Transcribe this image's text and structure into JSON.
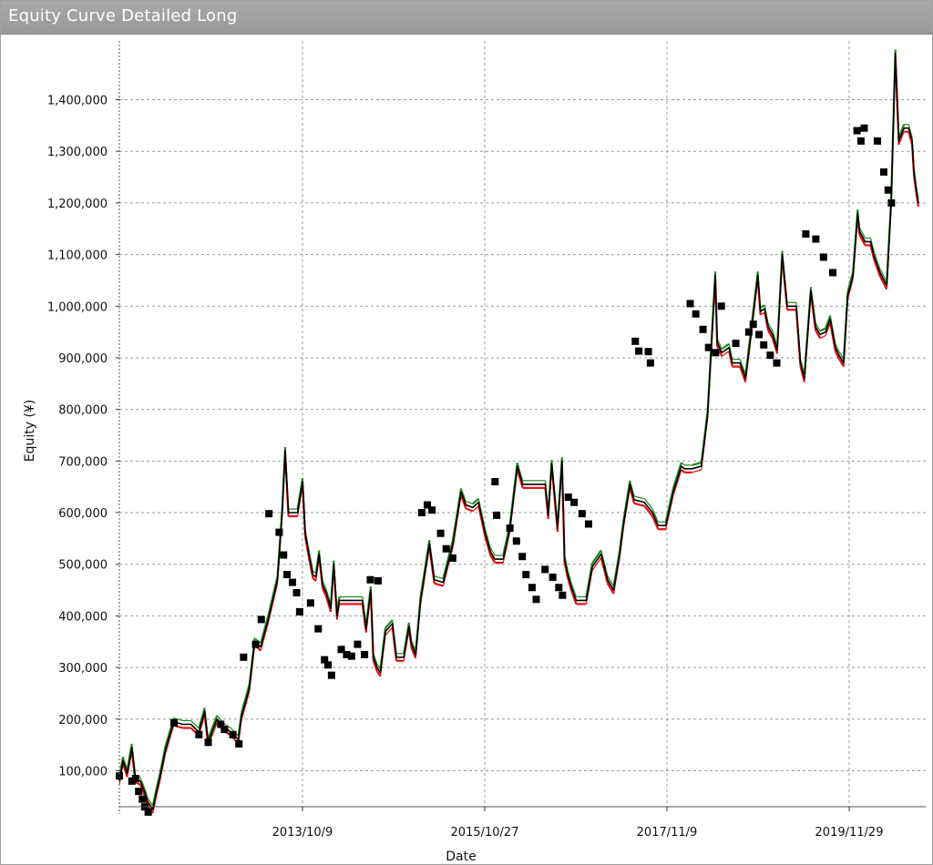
{
  "window": {
    "title": "Equity Curve Detailed Long"
  },
  "chart_data": {
    "type": "line",
    "title": "Equity Curve Detailed Long",
    "xlabel": "Date",
    "ylabel": "Equity (¥)",
    "ylim": [
      20000,
      1500000
    ],
    "xlim": [
      "2011-10-19",
      "2021-03-15"
    ],
    "grid": true,
    "x_tick_labels": [
      "2013/10/9",
      "2015/10/27",
      "2017/11/9",
      "2019/11/29"
    ],
    "y_ticks": [
      100000,
      200000,
      300000,
      400000,
      500000,
      600000,
      700000,
      800000,
      900000,
      1000000,
      1100000,
      1200000,
      1300000,
      1400000
    ],
    "y_tick_labels": [
      "100,000",
      "200,000",
      "300,000",
      "400,000",
      "500,000",
      "600,000",
      "700,000",
      "800,000",
      "900,000",
      "1,000,000",
      "1,100,000",
      "1,200,000",
      "1,300,000",
      "1,400,000"
    ],
    "colors": {
      "curve": "#000000",
      "gain_band": "#1a8a1a",
      "loss_band": "#e01010",
      "markers": "#000000"
    },
    "series": [
      {
        "values": [
          [
            "2011-10-19",
            80000
          ],
          [
            "2011-11-04",
            120000
          ],
          [
            "2011-11-22",
            95000
          ],
          [
            "2011-12-12",
            145000
          ],
          [
            "2011-12-27",
            85000
          ],
          [
            "2012-01-17",
            80000
          ],
          [
            "2012-02-04",
            60000
          ],
          [
            "2012-02-18",
            40000
          ],
          [
            "2012-03-11",
            25000
          ],
          [
            "2012-03-25",
            55000
          ],
          [
            "2012-04-12",
            90000
          ],
          [
            "2012-05-04",
            140000
          ],
          [
            "2012-06-09",
            195000
          ],
          [
            "2012-07-17",
            190000
          ],
          [
            "2012-08-22",
            190000
          ],
          [
            "2012-09-25",
            175000
          ],
          [
            "2012-10-20",
            215000
          ],
          [
            "2012-11-04",
            155000
          ],
          [
            "2012-12-12",
            200000
          ],
          [
            "2013-01-09",
            185000
          ],
          [
            "2013-02-11",
            175000
          ],
          [
            "2013-03-14",
            160000
          ],
          [
            "2013-03-27",
            205000
          ],
          [
            "2013-04-30",
            260000
          ],
          [
            "2013-05-23",
            350000
          ],
          [
            "2013-06-18",
            340000
          ],
          [
            "2013-07-21",
            395000
          ],
          [
            "2013-08-29",
            470000
          ],
          [
            "2013-09-18",
            600000
          ],
          [
            "2013-10-01",
            720000
          ],
          [
            "2013-10-15",
            600000
          ],
          [
            "2013-11-23",
            600000
          ],
          [
            "2013-12-15",
            660000
          ],
          [
            "2013-12-26",
            560000
          ],
          [
            "2014-01-13",
            515000
          ],
          [
            "2014-01-28",
            480000
          ],
          [
            "2014-02-10",
            475000
          ],
          [
            "2014-02-24",
            520000
          ],
          [
            "2014-03-11",
            460000
          ],
          [
            "2014-03-26",
            445000
          ],
          [
            "2014-04-15",
            415000
          ],
          [
            "2014-04-28",
            500000
          ],
          [
            "2014-05-12",
            400000
          ],
          [
            "2014-05-22",
            430000
          ],
          [
            "2014-06-14",
            430000
          ],
          [
            "2014-07-17",
            430000
          ],
          [
            "2014-08-29",
            430000
          ],
          [
            "2014-09-14",
            375000
          ],
          [
            "2014-10-04",
            450000
          ],
          [
            "2014-10-15",
            320000
          ],
          [
            "2014-10-31",
            300000
          ],
          [
            "2014-11-14",
            290000
          ],
          [
            "2014-12-06",
            370000
          ],
          [
            "2015-01-05",
            385000
          ],
          [
            "2015-01-22",
            320000
          ],
          [
            "2015-02-23",
            320000
          ],
          [
            "2015-03-17",
            380000
          ],
          [
            "2015-03-28",
            345000
          ],
          [
            "2015-04-15",
            325000
          ],
          [
            "2015-05-06",
            430000
          ],
          [
            "2015-06-13",
            540000
          ],
          [
            "2015-07-04",
            470000
          ],
          [
            "2015-08-11",
            465000
          ],
          [
            "2015-09-22",
            540000
          ],
          [
            "2015-10-27",
            640000
          ],
          [
            "2015-11-17",
            615000
          ],
          [
            "2015-12-16",
            610000
          ],
          [
            "2016-01-10",
            620000
          ],
          [
            "2016-02-08",
            560000
          ],
          [
            "2016-03-01",
            525000
          ],
          [
            "2016-03-20",
            510000
          ],
          [
            "2016-04-25",
            510000
          ],
          [
            "2016-05-24",
            570000
          ],
          [
            "2016-06-25",
            690000
          ],
          [
            "2016-07-18",
            655000
          ],
          [
            "2016-09-12",
            655000
          ],
          [
            "2016-10-23",
            655000
          ],
          [
            "2016-11-05",
            595000
          ],
          [
            "2016-11-20",
            695000
          ],
          [
            "2016-12-15",
            570000
          ],
          [
            "2017-01-03",
            700000
          ],
          [
            "2017-01-14",
            510000
          ],
          [
            "2017-01-28",
            480000
          ],
          [
            "2017-02-13",
            455000
          ],
          [
            "2017-03-05",
            430000
          ],
          [
            "2017-04-17",
            430000
          ],
          [
            "2017-05-13",
            495000
          ],
          [
            "2017-06-20",
            520000
          ],
          [
            "2017-07-18",
            470000
          ],
          [
            "2017-08-13",
            450000
          ],
          [
            "2017-09-08",
            520000
          ],
          [
            "2017-09-25",
            580000
          ],
          [
            "2017-10-22",
            655000
          ],
          [
            "2017-11-09",
            625000
          ],
          [
            "2017-12-23",
            620000
          ],
          [
            "2018-01-27",
            600000
          ],
          [
            "2018-02-20",
            575000
          ],
          [
            "2018-03-25",
            575000
          ],
          [
            "2018-04-26",
            640000
          ],
          [
            "2018-05-31",
            690000
          ],
          [
            "2018-06-13",
            685000
          ],
          [
            "2018-07-16",
            685000
          ],
          [
            "2018-08-25",
            690000
          ],
          [
            "2018-09-21",
            790000
          ],
          [
            "2018-10-24",
            1060000
          ],
          [
            "2018-11-01",
            930000
          ],
          [
            "2018-11-21",
            910000
          ],
          [
            "2018-12-22",
            920000
          ],
          [
            "2019-01-05",
            890000
          ],
          [
            "2019-02-07",
            890000
          ],
          [
            "2019-03-03",
            860000
          ],
          [
            "2019-03-22",
            930000
          ],
          [
            "2019-04-25",
            1060000
          ],
          [
            "2019-05-06",
            990000
          ],
          [
            "2019-05-24",
            995000
          ],
          [
            "2019-06-08",
            960000
          ],
          [
            "2019-06-27",
            945000
          ],
          [
            "2019-07-17",
            915000
          ],
          [
            "2019-08-08",
            1100000
          ],
          [
            "2019-08-29",
            1000000
          ],
          [
            "2019-09-14",
            1000000
          ],
          [
            "2019-10-07",
            1000000
          ],
          [
            "2019-10-25",
            890000
          ],
          [
            "2019-11-11",
            860000
          ],
          [
            "2019-12-09",
            1030000
          ],
          [
            "2019-12-29",
            960000
          ],
          [
            "2020-01-17",
            945000
          ],
          [
            "2020-02-10",
            950000
          ],
          [
            "2020-03-01",
            975000
          ],
          [
            "2020-03-23",
            920000
          ],
          [
            "2020-04-08",
            905000
          ],
          [
            "2020-04-28",
            890000
          ],
          [
            "2020-05-15",
            1020000
          ],
          [
            "2020-06-07",
            1060000
          ],
          [
            "2020-06-27",
            1180000
          ],
          [
            "2020-07-05",
            1145000
          ],
          [
            "2020-07-29",
            1125000
          ],
          [
            "2020-08-21",
            1125000
          ],
          [
            "2020-09-07",
            1095000
          ],
          [
            "2020-10-01",
            1065000
          ],
          [
            "2020-10-30",
            1040000
          ],
          [
            "2020-11-18",
            1200000
          ],
          [
            "2020-12-06",
            1490000
          ],
          [
            "2020-12-21",
            1320000
          ],
          [
            "2021-01-12",
            1345000
          ],
          [
            "2021-02-01",
            1345000
          ],
          [
            "2021-02-16",
            1320000
          ],
          [
            "2021-02-24",
            1260000
          ],
          [
            "2021-03-06",
            1225000
          ],
          [
            "2021-03-15",
            1200000
          ]
        ]
      }
    ],
    "markers": [
      [
        "2011-10-19",
        90000
      ],
      [
        "2011-12-12",
        80000
      ],
      [
        "2011-12-28",
        85000
      ],
      [
        "2012-01-10",
        60000
      ],
      [
        "2012-01-26",
        45000
      ],
      [
        "2012-02-05",
        30000
      ],
      [
        "2012-02-20",
        20000
      ],
      [
        "2012-06-10",
        193000
      ],
      [
        "2012-09-25",
        170000
      ],
      [
        "2012-11-04",
        155000
      ],
      [
        "2012-12-28",
        190000
      ],
      [
        "2013-01-13",
        180000
      ],
      [
        "2013-02-18",
        170000
      ],
      [
        "2013-03-16",
        152000
      ],
      [
        "2013-04-05",
        320000
      ],
      [
        "2013-05-27",
        345000
      ],
      [
        "2013-06-20",
        393000
      ],
      [
        "2013-07-23",
        598000
      ],
      [
        "2013-09-05",
        562000
      ],
      [
        "2013-09-24",
        518000
      ],
      [
        "2013-10-09",
        480000
      ],
      [
        "2013-11-01",
        465000
      ],
      [
        "2013-11-19",
        445000
      ],
      [
        "2013-12-02",
        408000
      ],
      [
        "2014-01-18",
        425000
      ],
      [
        "2014-02-20",
        375000
      ],
      [
        "2014-03-19",
        315000
      ],
      [
        "2014-04-03",
        305000
      ],
      [
        "2014-04-18",
        285000
      ],
      [
        "2014-05-30",
        335000
      ],
      [
        "2014-06-22",
        325000
      ],
      [
        "2014-07-13",
        322000
      ],
      [
        "2014-08-08",
        345000
      ],
      [
        "2014-09-07",
        325000
      ],
      [
        "2014-10-02",
        470000
      ],
      [
        "2014-11-04",
        468000
      ],
      [
        "2015-05-11",
        600000
      ],
      [
        "2015-06-04",
        615000
      ],
      [
        "2015-06-24",
        605000
      ],
      [
        "2015-07-31",
        560000
      ],
      [
        "2015-08-24",
        530000
      ],
      [
        "2015-09-21",
        512000
      ],
      [
        "2016-03-21",
        660000
      ],
      [
        "2016-03-28",
        595000
      ],
      [
        "2016-05-24",
        570000
      ],
      [
        "2016-06-21",
        545000
      ],
      [
        "2016-07-16",
        515000
      ],
      [
        "2016-08-01",
        480000
      ],
      [
        "2016-08-27",
        455000
      ],
      [
        "2016-09-14",
        432000
      ],
      [
        "2016-10-22",
        490000
      ],
      [
        "2016-11-24",
        475000
      ],
      [
        "2016-12-20",
        455000
      ],
      [
        "2017-01-05",
        440000
      ],
      [
        "2017-01-30",
        630000
      ],
      [
        "2017-02-24",
        620000
      ],
      [
        "2017-03-30",
        598000
      ],
      [
        "2017-04-27",
        578000
      ],
      [
        "2017-11-14",
        932000
      ],
      [
        "2017-11-29",
        913000
      ],
      [
        "2018-01-09",
        912000
      ],
      [
        "2018-01-18",
        890000
      ],
      [
        "2018-07-08",
        1005000
      ],
      [
        "2018-08-01",
        985000
      ],
      [
        "2018-09-01",
        955000
      ],
      [
        "2018-09-25",
        920000
      ],
      [
        "2018-10-25",
        910000
      ],
      [
        "2018-11-19",
        1000000
      ],
      [
        "2019-01-20",
        928000
      ],
      [
        "2019-03-17",
        950000
      ],
      [
        "2019-04-05",
        965000
      ],
      [
        "2019-04-30",
        945000
      ],
      [
        "2019-05-20",
        925000
      ],
      [
        "2019-06-17",
        905000
      ],
      [
        "2019-07-15",
        890000
      ],
      [
        "2019-11-17",
        1140000
      ],
      [
        "2019-12-30",
        1130000
      ],
      [
        "2020-02-01",
        1095000
      ],
      [
        "2020-03-12",
        1065000
      ],
      [
        "2020-06-24",
        1340000
      ],
      [
        "2020-07-11",
        1320000
      ],
      [
        "2020-07-25",
        1345000
      ],
      [
        "2020-09-20",
        1320000
      ],
      [
        "2020-10-17",
        1260000
      ],
      [
        "2020-11-05",
        1225000
      ],
      [
        "2020-11-19",
        1200000
      ]
    ]
  }
}
